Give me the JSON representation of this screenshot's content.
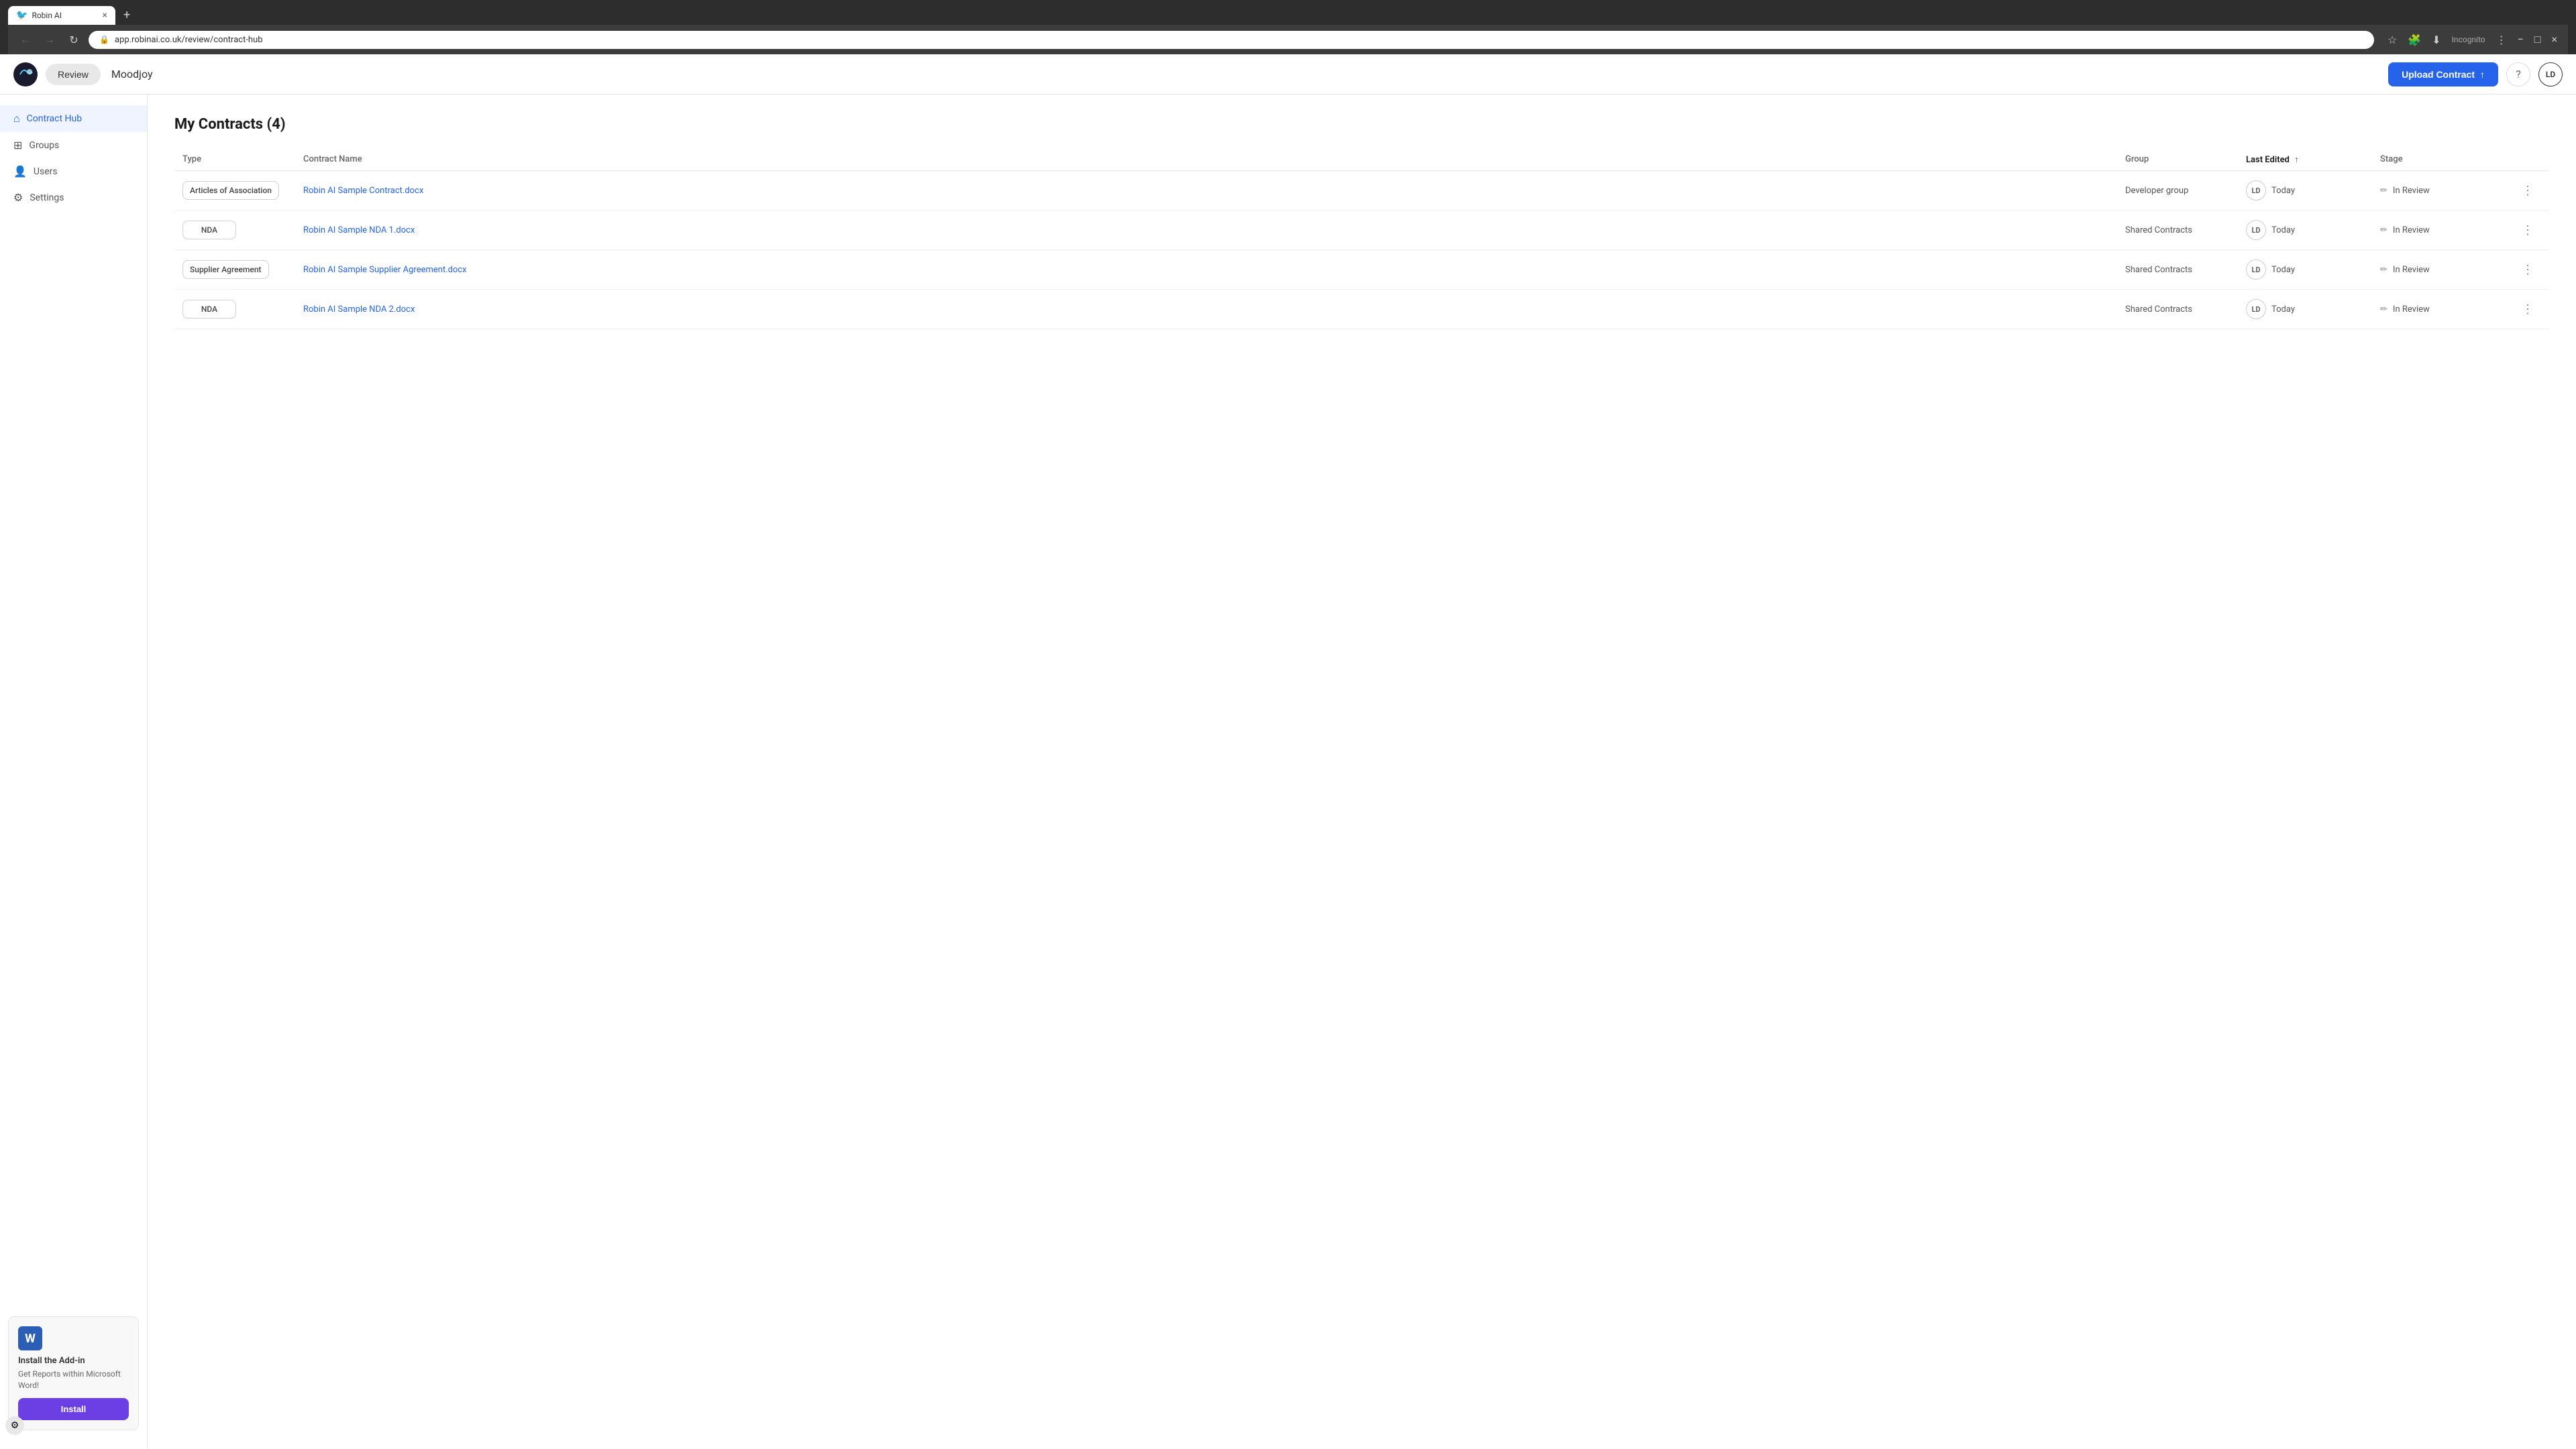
{
  "browser": {
    "tab_label": "Robin AI",
    "tab_close": "×",
    "new_tab": "+",
    "nav_back": "←",
    "nav_forward": "→",
    "nav_reload": "↻",
    "url": "app.robinai.co.uk/review/contract-hub",
    "incognito_label": "Incognito",
    "window_min": "−",
    "window_max": "□",
    "window_close": "×"
  },
  "header": {
    "review_label": "Review",
    "app_name": "Moodjoy",
    "upload_button_label": "Upload Contract",
    "upload_icon": "↑",
    "help_icon": "?",
    "avatar_label": "LD"
  },
  "sidebar": {
    "items": [
      {
        "id": "contract-hub",
        "label": "Contract Hub",
        "icon": "⊞",
        "active": true
      },
      {
        "id": "groups",
        "label": "Groups",
        "icon": "⊟",
        "active": false
      },
      {
        "id": "users",
        "label": "Users",
        "icon": "○",
        "active": false
      },
      {
        "id": "settings",
        "label": "Settings",
        "icon": "⚙",
        "active": false
      }
    ],
    "addon": {
      "word_icon": "W",
      "title": "Install the Add-in",
      "desc": "Get Reports within Microsoft Word!",
      "install_label": "Install"
    }
  },
  "content": {
    "page_title": "My Contracts (4)",
    "table": {
      "columns": [
        "Type",
        "Contract Name",
        "Group",
        "Last Edited",
        "Stage",
        ""
      ],
      "sort_column": "Last Edited",
      "rows": [
        {
          "type": "Articles of Association",
          "contract_name": "Robin AI Sample Contract.docx",
          "group": "Developer group",
          "avatar": "LD",
          "last_edited": "Today",
          "stage": "In Review"
        },
        {
          "type": "NDA",
          "contract_name": "Robin AI Sample NDA 1.docx",
          "group": "Shared Contracts",
          "avatar": "LD",
          "last_edited": "Today",
          "stage": "In Review"
        },
        {
          "type": "Supplier Agreement",
          "contract_name": "Robin AI Sample Supplier Agreement.docx",
          "group": "Shared Contracts",
          "avatar": "LD",
          "last_edited": "Today",
          "stage": "In Review"
        },
        {
          "type": "NDA",
          "contract_name": "Robin AI Sample NDA 2.docx",
          "group": "Shared Contracts",
          "avatar": "LD",
          "last_edited": "Today",
          "stage": "In Review"
        }
      ]
    }
  },
  "colors": {
    "primary": "#2563eb",
    "install": "#6b3fe4",
    "active_nav": "#f0f4ff",
    "active_nav_text": "#2563eb"
  }
}
